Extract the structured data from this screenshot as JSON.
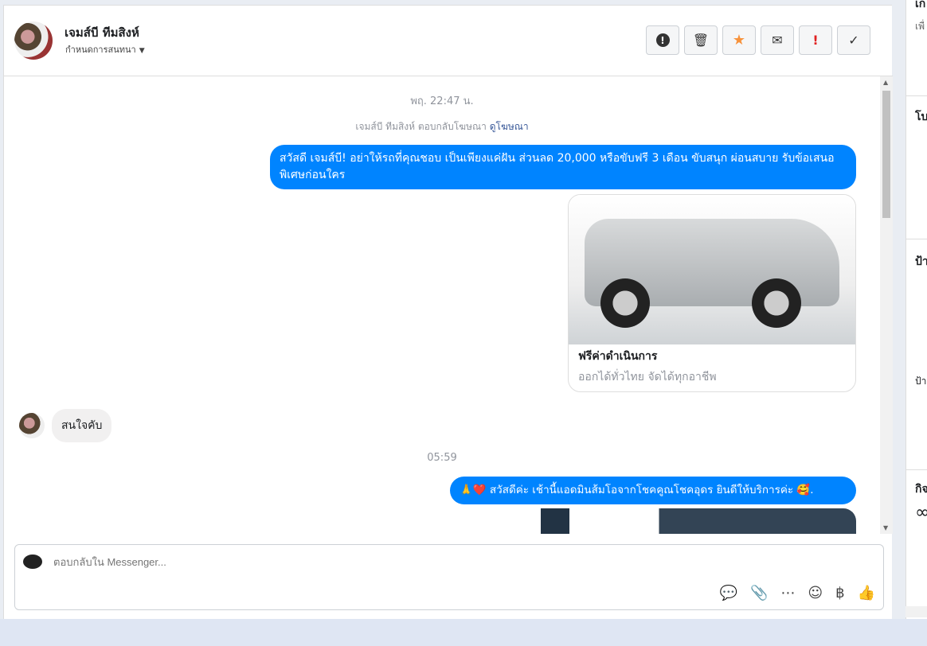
{
  "header": {
    "name": "เจมส์บี ทีมสิงห์",
    "subtitle": "กำหนดการสนทนา",
    "buttons": [
      {
        "name": "spam-button",
        "glyph": "!"
      },
      {
        "name": "delete-button",
        "glyph": "🗑"
      },
      {
        "name": "star-button",
        "glyph": "★"
      },
      {
        "name": "unread-button",
        "glyph": "✉"
      },
      {
        "name": "follow-up-button",
        "glyph": "!"
      },
      {
        "name": "done-button",
        "glyph": "✓"
      }
    ]
  },
  "messages": {
    "timestamp1": "พฤ. 22:47 น.",
    "ad_reply": "เจมส์บี ทีมสิงห์ ตอบกลับโฆษณา",
    "ad_link": "ดูโฆษณา",
    "outgoing1": "สวัสดี เจมส์บี! อย่าให้รถที่คุณชอบ เป็นเพียงแค่ฝัน ส่วนลด 20,000 หรือขับฟรี 3 เดือน ขับสนุก ผ่อนสบาย รับข้อเสนอพิเศษก่อนใคร",
    "card_title": "ฟรีค่าดำเนินการ",
    "card_subtitle": "ออกได้ทั่วไทย จัดได้ทุกอาชีพ",
    "incoming1": "สนใจคับ",
    "timestamp2": "05:59",
    "outgoing2": "🙏❤️ สวัสดีค่ะ เช้านี้แอดมินส้มโอจากโชคคูณโชคอุดร ยินดีให้บริการค่ะ 🥰."
  },
  "composer": {
    "placeholder": "ตอบกลับใน Messenger..."
  },
  "right_panel": {
    "fragments": [
      "เก",
      "เพื่",
      "โบ",
      "ป้า",
      "ป้า",
      "กิจ",
      "∞"
    ]
  }
}
